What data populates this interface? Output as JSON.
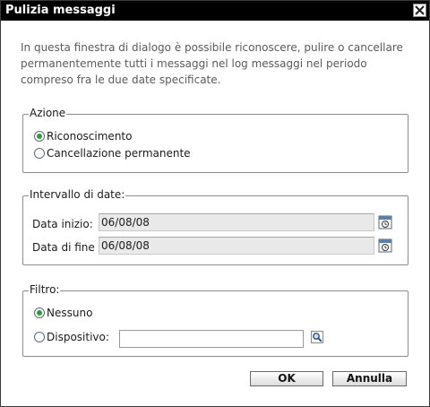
{
  "dialog": {
    "title": "Pulizia messaggi",
    "intro": "In questa finestra di dialogo è possibile riconoscere, pulire o cancellare permanentemente tutti i messaggi nel log messaggi nel periodo compreso fra le due date specificate."
  },
  "action_group": {
    "legend": "Azione",
    "options": [
      {
        "label": "Riconoscimento",
        "selected": true
      },
      {
        "label": "Cancellazione permanente",
        "selected": false
      }
    ]
  },
  "date_group": {
    "legend": "Intervallo di date:",
    "start_label": "Data inizio:",
    "start_value": "06/08/08",
    "end_label": "Data di fine",
    "end_value": "06/08/08"
  },
  "filter_group": {
    "legend": "Filtro:",
    "options": [
      {
        "label": "Nessuno",
        "selected": true
      },
      {
        "label": "Dispositivo:",
        "selected": false
      }
    ],
    "device_value": ""
  },
  "buttons": {
    "ok": "OK",
    "cancel": "Annulla"
  },
  "icons": {
    "close": "close-icon",
    "calendar": "calendar-icon",
    "search": "search-icon"
  },
  "colors": {
    "titlebar": "#000000",
    "radio_selected": "#2c9b3a",
    "intro_text": "#5a5a5a"
  }
}
